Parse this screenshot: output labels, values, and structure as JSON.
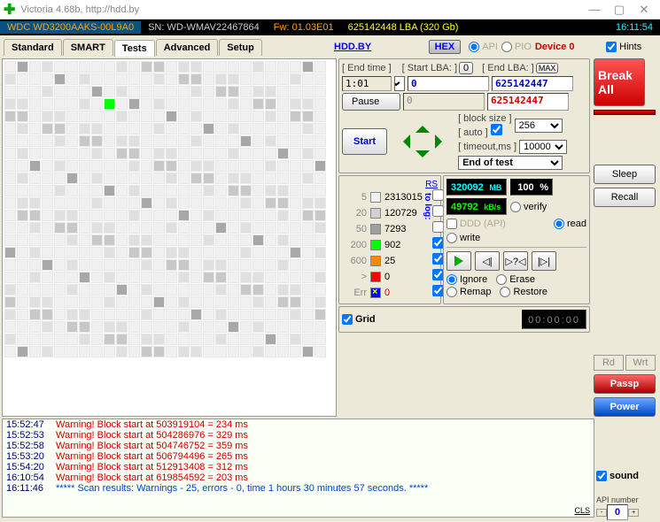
{
  "window": {
    "title": "Victoria 4.68b, http://hdd.by"
  },
  "info": {
    "model": "WDC WD3200AAKS-00L9A0",
    "serial": "SN: WD-WMAV22467864",
    "fw": "Fw: 01.03E01",
    "lba": "625142448 LBA (320 Gb)",
    "time": "16:11:54"
  },
  "tabs": {
    "t1": "Standard",
    "t2": "SMART",
    "t3": "Tests",
    "t4": "Advanced",
    "t5": "Setup",
    "link": "HDD.BY",
    "hex": "HEX",
    "api": "API",
    "pio": "PIO",
    "device": "Device 0",
    "hints": "Hints"
  },
  "scan": {
    "endtime_lbl": "[ End time ]",
    "endtime": "1:01",
    "startlba_lbl": "[ Start LBA: ]",
    "startlba_btn": "0",
    "start_val": "0",
    "start_cur": "0",
    "endlba_lbl": "[ End LBA: ]",
    "max": "MAX",
    "end_val": "625142447",
    "end_cur": "625142447",
    "pause": "Pause",
    "start_btn": "Start",
    "block_lbl": "[ block size ]",
    "auto_lbl": "[ auto ]",
    "block": "256",
    "timeout_lbl": "[ timeout,ms ]",
    "timeout": "10000",
    "action": "End of test"
  },
  "stats": {
    "rs": "RS",
    "tolog": "to log:",
    "l0_n": "5",
    "l0_v": "2313015",
    "l1_n": "20",
    "l1_v": "120729",
    "l2_n": "50",
    "l2_v": "7293",
    "l3_n": "200",
    "l3_v": "902",
    "l4_n": "600",
    "l4_v": "25",
    "l5_n": ">",
    "l5_v": "0",
    "le_n": "Err",
    "le_v": "0"
  },
  "speed": {
    "mb": "320092",
    "mb_u": "MB",
    "pct": "100",
    "pct_u": "%",
    "kbs": "49792",
    "kbs_u": "kB/s",
    "ddd": "DDD (API)",
    "verify": "verify",
    "read": "read",
    "write": "write"
  },
  "actions": {
    "ignore": "Ignore",
    "erase": "Erase",
    "remap": "Remap",
    "restore": "Restore",
    "grid": "Grid",
    "timer": "00:00:00"
  },
  "side": {
    "break": "Break All",
    "sleep": "Sleep",
    "recall": "Recall",
    "rd": "Rd",
    "wrt": "Wrt",
    "passp": "Passp",
    "power": "Power",
    "sound": "sound",
    "api_lbl": "API number",
    "api_n": "0"
  },
  "log": [
    {
      "t": "15:52:47",
      "m": "Warning! Block start at 503919104 = 234 ms"
    },
    {
      "t": "15:52:53",
      "m": "Warning! Block start at 504286976 = 329 ms"
    },
    {
      "t": "15:52:58",
      "m": "Warning! Block start at 504746752 = 359 ms"
    },
    {
      "t": "15:53:20",
      "m": "Warning! Block start at 506794496 = 265 ms"
    },
    {
      "t": "15:54:20",
      "m": "Warning! Block start at 512913408 = 312 ms"
    },
    {
      "t": "16:10:54",
      "m": "Warning! Block start at 619854592 = 203 ms"
    }
  ],
  "summary": {
    "t": "16:11:46",
    "m": "*****  Scan results: Warnings - 25, errors - 0, time 1 hours 30 minutes 57 seconds.   *****"
  },
  "cls": "CLS"
}
